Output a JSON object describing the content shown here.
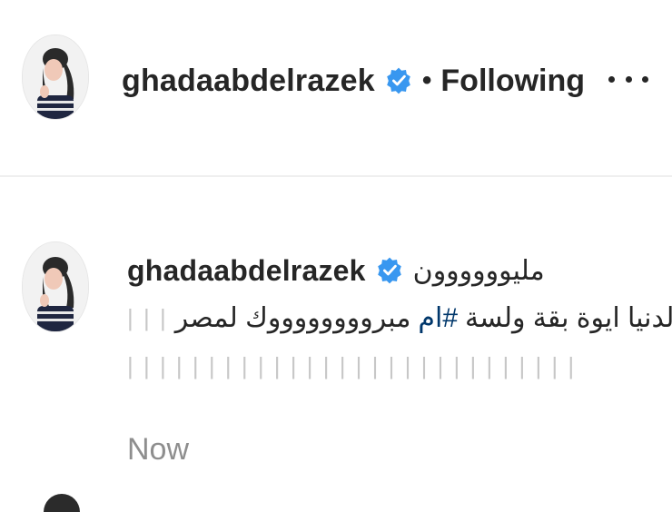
{
  "post_header": {
    "username": "ghadaabdelrazek",
    "separator": "•",
    "follow_status": "Following",
    "more_icon": "more-horizontal-icon"
  },
  "comment": {
    "username": "ghadaabdelrazek",
    "line1_tail": "مليوووووون",
    "line2_text": "مبرووووووووك لمصر",
    "line2_hashtag": "#ام",
    "line2_rest": "الدنيا ايوة بقة ولسة",
    "line2_bars": "| | |",
    "line3_bars": "| | | | | | | | | | | | | | | | | | | | | | | | | | | |",
    "timestamp": "Now"
  },
  "colors": {
    "verified": "#3897f0",
    "text": "#262626",
    "muted": "#8e8e8e",
    "hashtag": "#00376b"
  }
}
